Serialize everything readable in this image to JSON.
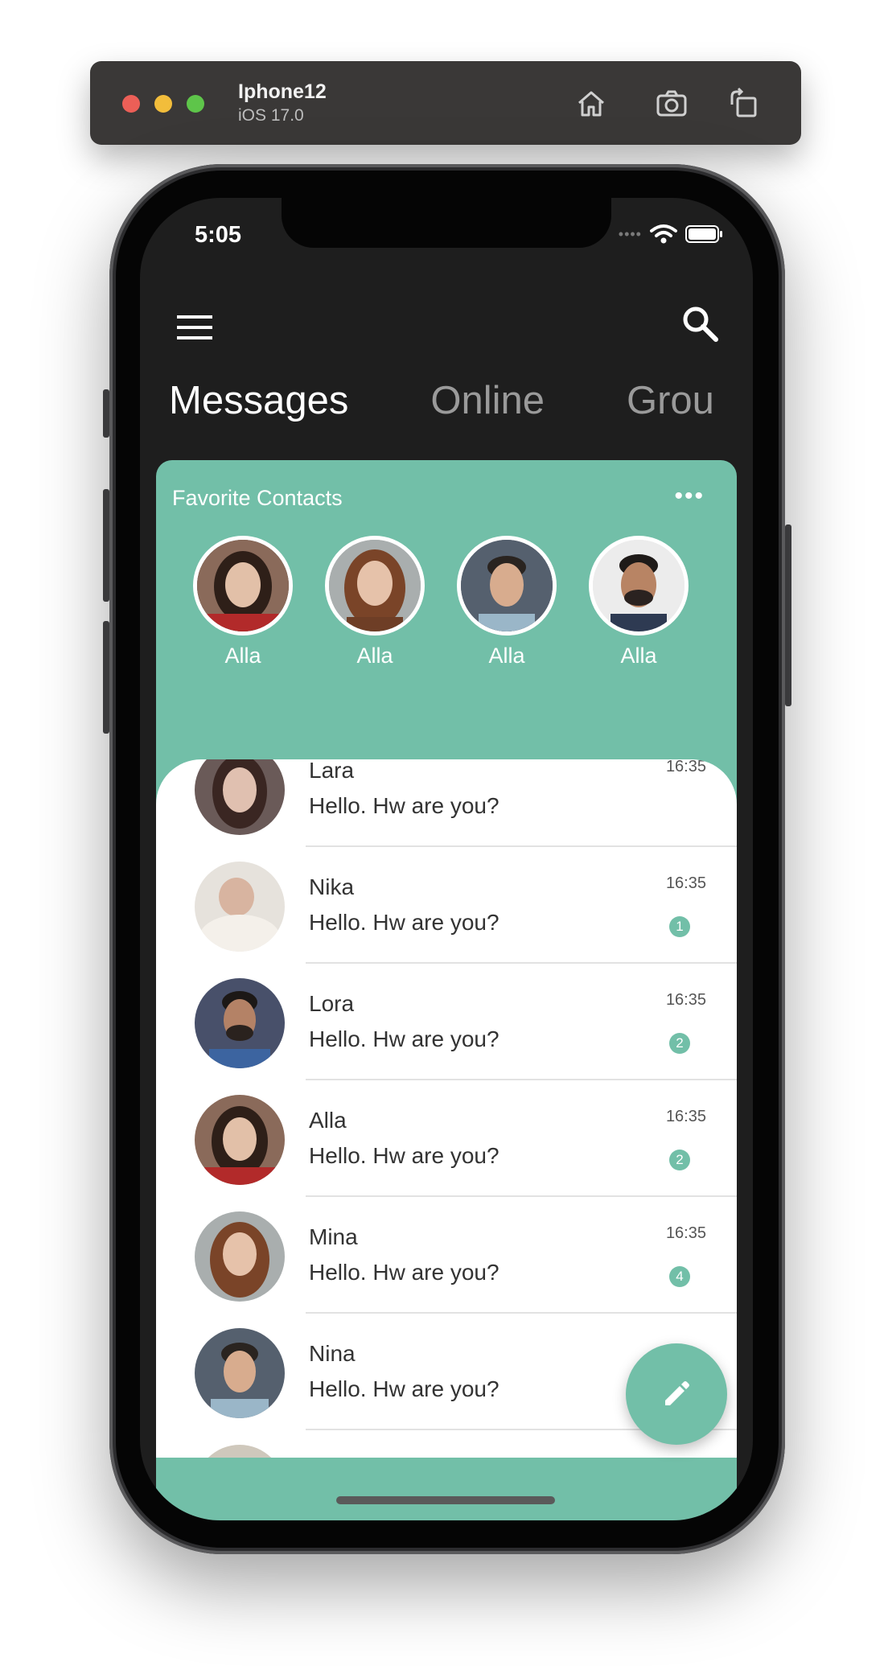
{
  "simulator": {
    "device_name": "Iphone12",
    "os_version": "iOS 17.0",
    "buttons": [
      "home-icon",
      "screenshot-icon",
      "rotate-icon"
    ]
  },
  "status_bar": {
    "time": "5:05",
    "signal": "••••"
  },
  "header": {
    "tabs": [
      {
        "label": "Messages",
        "active": true
      },
      {
        "label": "Online",
        "active": false
      },
      {
        "label": "Grou",
        "active": false
      }
    ]
  },
  "favorites": {
    "title": "Favorite Contacts",
    "more_label": "•••",
    "contacts": [
      {
        "name": "Alla",
        "avatar": "avatar-woman-dark-hair"
      },
      {
        "name": "Alla",
        "avatar": "avatar-woman-auburn-hair"
      },
      {
        "name": "Alla",
        "avatar": "avatar-man-short-hair"
      },
      {
        "name": "Alla",
        "avatar": "avatar-man-beard"
      }
    ]
  },
  "chats": [
    {
      "name": "Lara",
      "message": "Hello. Hw are you?",
      "time": "16:35",
      "unread": ""
    },
    {
      "name": "Nika",
      "message": "Hello. Hw are you?",
      "time": "16:35",
      "unread": "1"
    },
    {
      "name": "Lora",
      "message": "Hello. Hw are you?",
      "time": "16:35",
      "unread": "2"
    },
    {
      "name": "Alla",
      "message": "Hello. Hw are you?",
      "time": "16:35",
      "unread": "2"
    },
    {
      "name": "Mina",
      "message": "Hello. Hw are you?",
      "time": "16:35",
      "unread": "4"
    },
    {
      "name": "Nina",
      "message": "Hello. Hw are you?",
      "time": "",
      "unread": ""
    }
  ],
  "colors": {
    "accent": "#72bfa8",
    "background": "#1e1e1e",
    "panel": "#ffffff"
  },
  "fab": {
    "icon": "pencil-icon"
  }
}
